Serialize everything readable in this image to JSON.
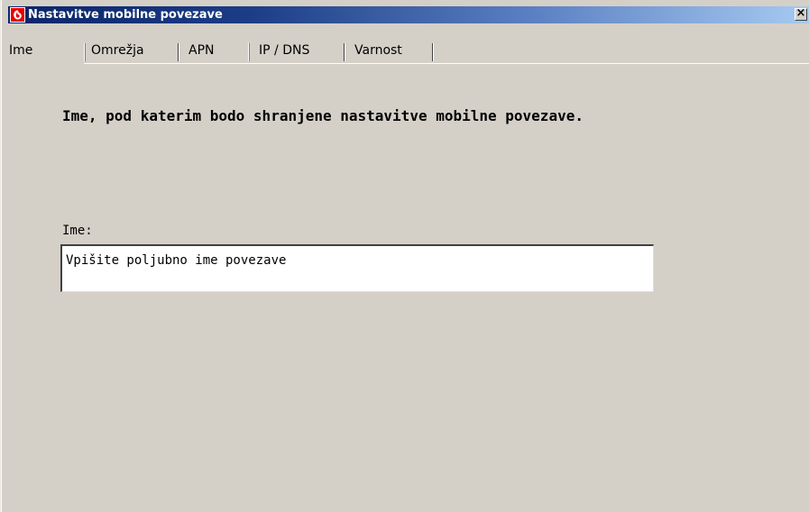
{
  "window": {
    "title": "Nastavitve mobilne povezave",
    "close_glyph": "×"
  },
  "tabs": [
    {
      "label": "Ime",
      "active": true
    },
    {
      "label": "Omrežja",
      "active": false
    },
    {
      "label": "APN",
      "active": false
    },
    {
      "label": "IP / DNS",
      "active": false
    },
    {
      "label": "Varnost",
      "active": false
    }
  ],
  "page": {
    "heading": "Ime, pod katerim bodo shranjene nastavitve mobilne povezave.",
    "name_label": "Ime:",
    "name_value": "Vpišite poljubno ime povezave"
  },
  "colors": {
    "background": "#d4d0c8",
    "titlebar_start": "#0a246a",
    "titlebar_end": "#a6caf0",
    "logo_red": "#e60000"
  },
  "icons": {
    "app_logo": "vodafone-logo-icon",
    "close": "close-icon"
  }
}
